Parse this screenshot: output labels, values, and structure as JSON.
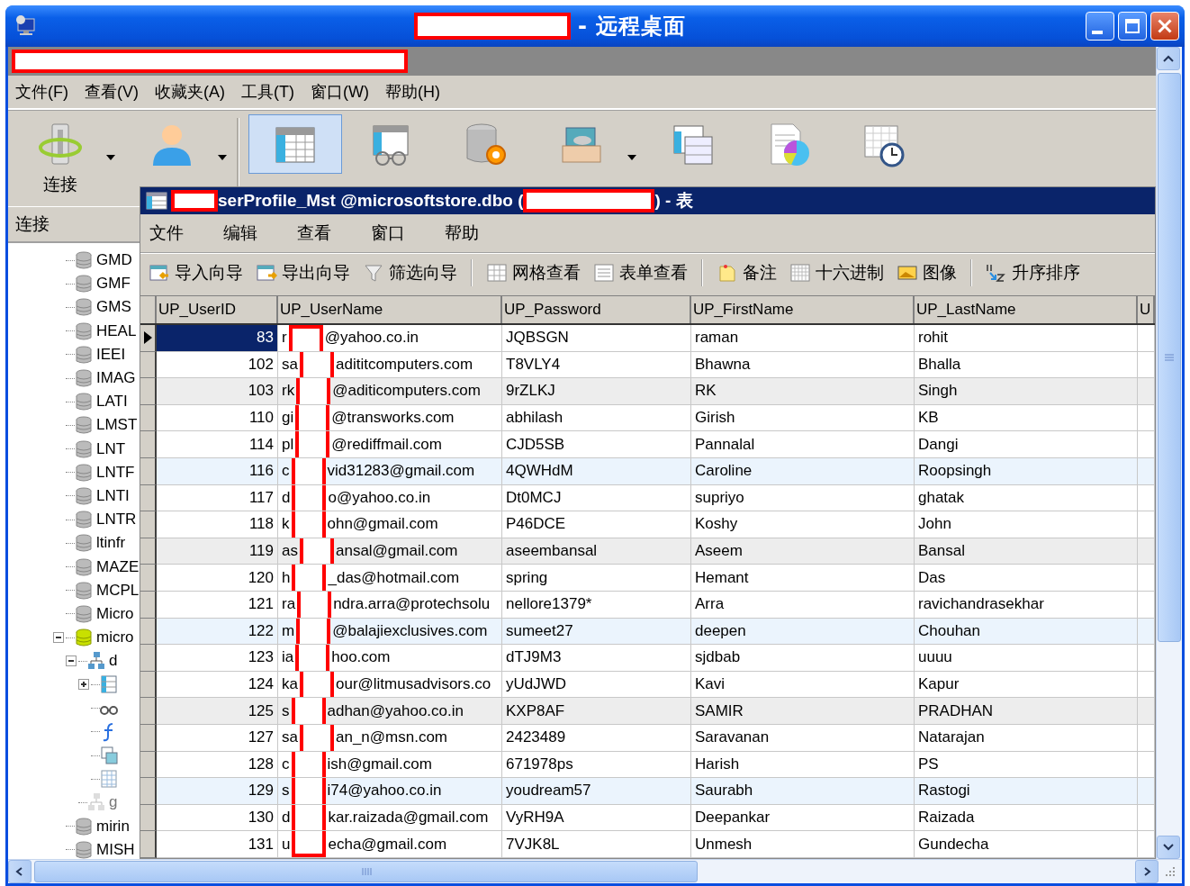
{
  "window": {
    "title_redacted": true,
    "title": "- 远程桌面"
  },
  "remote": {
    "address_redacted": true,
    "menu": [
      "文件(F)",
      "查看(V)",
      "收藏夹(A)",
      "工具(T)",
      "窗口(W)",
      "帮助(H)"
    ],
    "toolbar": [
      {
        "kind": "connect",
        "label": "连接",
        "dropdown": true,
        "selected": false
      },
      {
        "kind": "user",
        "dropdown": true,
        "selected": false
      },
      {
        "kind": "separator"
      },
      {
        "kind": "table",
        "dropdown": false,
        "selected": true
      },
      {
        "kind": "view",
        "dropdown": false,
        "selected": false
      },
      {
        "kind": "function",
        "dropdown": false,
        "selected": false
      },
      {
        "kind": "other",
        "dropdown": true,
        "selected": false
      },
      {
        "kind": "query",
        "dropdown": false,
        "selected": false
      },
      {
        "kind": "report",
        "dropdown": false,
        "selected": false
      },
      {
        "kind": "schedule",
        "dropdown": false,
        "selected": false
      }
    ],
    "panel": {
      "title": "连接",
      "tree": [
        {
          "label": "GMD",
          "kind": "database",
          "open": false
        },
        {
          "label": "GMF",
          "kind": "database",
          "open": false
        },
        {
          "label": "GMS",
          "kind": "database",
          "open": false
        },
        {
          "label": "HEAL",
          "kind": "database",
          "open": false
        },
        {
          "label": "IEEI",
          "kind": "database",
          "open": false
        },
        {
          "label": "IMAG",
          "kind": "database",
          "open": false
        },
        {
          "label": "LATI",
          "kind": "database",
          "open": false
        },
        {
          "label": "LMST",
          "kind": "database",
          "open": false
        },
        {
          "label": "LNT",
          "kind": "database",
          "open": false
        },
        {
          "label": "LNTF",
          "kind": "database",
          "open": false
        },
        {
          "label": "LNTI",
          "kind": "database",
          "open": false
        },
        {
          "label": "LNTR",
          "kind": "database",
          "open": false
        },
        {
          "label": "ltinfr",
          "kind": "database",
          "open": false
        },
        {
          "label": "MAZE",
          "kind": "database",
          "open": false
        },
        {
          "label": "MCPL",
          "kind": "database",
          "open": false
        },
        {
          "label": "Micro",
          "kind": "database",
          "open": false
        },
        {
          "label": "micro",
          "kind": "database",
          "open": true,
          "expanded": true,
          "children": [
            {
              "label": "d",
              "kind": "schema",
              "expanded": true,
              "children": [
                {
                  "kind": "tables",
                  "expanded": false
                },
                {
                  "kind": "views"
                },
                {
                  "kind": "functions"
                },
                {
                  "kind": "queries"
                },
                {
                  "kind": "reports"
                }
              ]
            },
            {
              "label": "g",
              "kind": "schema-inactive"
            }
          ]
        },
        {
          "label": "mirin",
          "kind": "database",
          "open": false
        },
        {
          "label": "MISH",
          "kind": "database",
          "open": false
        }
      ]
    }
  },
  "table_window": {
    "title_redacted": true,
    "title_before": "serProfile_Mst @microsoftstore.dbo (",
    "title_after": ") - 表",
    "menu": [
      "文件",
      "编辑",
      "查看",
      "窗口",
      "帮助"
    ],
    "toolbar": [
      {
        "kind": "import",
        "label": "导入向导"
      },
      {
        "kind": "export",
        "label": "导出向导"
      },
      {
        "kind": "filter",
        "label": "筛选向导"
      },
      {
        "kind": "separator"
      },
      {
        "kind": "grid",
        "label": "网格查看"
      },
      {
        "kind": "form",
        "label": "表单查看"
      },
      {
        "kind": "separator"
      },
      {
        "kind": "memo",
        "label": "备注"
      },
      {
        "kind": "hex",
        "label": "十六进制"
      },
      {
        "kind": "image",
        "label": "图像"
      },
      {
        "kind": "separator"
      },
      {
        "kind": "sort",
        "label": "升序排序"
      }
    ],
    "grid": {
      "username_redacted": true,
      "columns": [
        "UP_UserID",
        "UP_UserName",
        "UP_Password",
        "UP_FirstName",
        "UP_LastName",
        "U"
      ],
      "rows": [
        {
          "user_id": "83",
          "username_prefix": "r",
          "username_suffix": "@yahoo.co.in",
          "password": "JQBSGN",
          "first_name": "raman",
          "last_name": "rohit",
          "selected": true,
          "color": "#ffffff"
        },
        {
          "user_id": "102",
          "username_prefix": "sa",
          "username_suffix": "adititcomputers.com",
          "password": "T8VLY4",
          "first_name": "Bhawna",
          "last_name": "Bhalla",
          "selected": false,
          "color": "#ffffff"
        },
        {
          "user_id": "103",
          "username_prefix": "rk",
          "username_suffix": "@aditicomputers.com",
          "password": "9rZLKJ",
          "first_name": "RK",
          "last_name": "Singh",
          "selected": false,
          "color": "#ededed"
        },
        {
          "user_id": "110",
          "username_prefix": "gi",
          "username_suffix": "@transworks.com",
          "password": "abhilash",
          "first_name": "Girish",
          "last_name": "KB",
          "selected": false,
          "color": "#ffffff"
        },
        {
          "user_id": "114",
          "username_prefix": "pl",
          "username_suffix": "@rediffmail.com",
          "password": "CJD5SB",
          "first_name": "Pannalal",
          "last_name": "Dangi",
          "selected": false,
          "color": "#ffffff"
        },
        {
          "user_id": "116",
          "username_prefix": "c",
          "username_suffix": "vid31283@gmail.com",
          "password": "4QWHdM",
          "first_name": "Caroline",
          "last_name": "Roopsingh",
          "selected": false,
          "color": "#ebf4fd"
        },
        {
          "user_id": "117",
          "username_prefix": "d",
          "username_suffix": "o@yahoo.co.in",
          "password": "Dt0MCJ",
          "first_name": "supriyo",
          "last_name": "ghatak",
          "selected": false,
          "color": "#ffffff"
        },
        {
          "user_id": "118",
          "username_prefix": "k",
          "username_suffix": "ohn@gmail.com",
          "password": "P46DCE",
          "first_name": "Koshy",
          "last_name": "John",
          "selected": false,
          "color": "#ffffff"
        },
        {
          "user_id": "119",
          "username_prefix": "as",
          "username_suffix": "ansal@gmail.com",
          "password": "aseembansal",
          "first_name": "Aseem",
          "last_name": "Bansal",
          "selected": false,
          "color": "#ededed"
        },
        {
          "user_id": "120",
          "username_prefix": "h",
          "username_suffix": "_das@hotmail.com",
          "password": "spring",
          "first_name": "Hemant",
          "last_name": "Das",
          "selected": false,
          "color": "#ffffff"
        },
        {
          "user_id": "121",
          "username_prefix": "ra",
          "username_suffix": "ndra.arra@protechsolu",
          "password": "nellore1379*",
          "first_name": "Arra",
          "last_name": "ravichandrasekhar",
          "selected": false,
          "color": "#ffffff"
        },
        {
          "user_id": "122",
          "username_prefix": "m",
          "username_suffix": "@balajiexclusives.com",
          "password": "sumeet27",
          "first_name": "deepen",
          "last_name": "Chouhan",
          "selected": false,
          "color": "#ebf4fd"
        },
        {
          "user_id": "123",
          "username_prefix": "ia",
          "username_suffix": "hoo.com",
          "password": "dTJ9M3",
          "first_name": "sjdbab",
          "last_name": "uuuu",
          "selected": false,
          "color": "#ffffff"
        },
        {
          "user_id": "124",
          "username_prefix": "ka",
          "username_suffix": "our@litmusadvisors.co",
          "password": "yUdJWD",
          "first_name": "Kavi",
          "last_name": "Kapur",
          "selected": false,
          "color": "#ffffff"
        },
        {
          "user_id": "125",
          "username_prefix": "s",
          "username_suffix": "adhan@yahoo.co.in",
          "password": "KXP8AF",
          "first_name": "SAMIR",
          "last_name": "PRADHAN",
          "selected": false,
          "color": "#ededed"
        },
        {
          "user_id": "127",
          "username_prefix": "sa",
          "username_suffix": "an_n@msn.com",
          "password": "2423489",
          "first_name": "Saravanan",
          "last_name": "Natarajan",
          "selected": false,
          "color": "#ffffff"
        },
        {
          "user_id": "128",
          "username_prefix": "c",
          "username_suffix": "ish@gmail.com",
          "password": "671978ps",
          "first_name": "Harish",
          "last_name": "PS",
          "selected": false,
          "color": "#ffffff"
        },
        {
          "user_id": "129",
          "username_prefix": "s",
          "username_suffix": "i74@yahoo.co.in",
          "password": "youdream57",
          "first_name": "Saurabh",
          "last_name": "Rastogi",
          "selected": false,
          "color": "#ebf4fd"
        },
        {
          "user_id": "130",
          "username_prefix": "d",
          "username_suffix": "kar.raizada@gmail.com",
          "password": "VyRH9A",
          "first_name": "Deepankar",
          "last_name": "Raizada",
          "selected": false,
          "color": "#ffffff"
        },
        {
          "user_id": "131",
          "username_prefix": "u",
          "username_suffix": "echa@gmail.com",
          "password": "7VJK8L",
          "first_name": "Unmesh",
          "last_name": "Gundecha",
          "selected": false,
          "color": "#ffffff"
        }
      ]
    }
  }
}
